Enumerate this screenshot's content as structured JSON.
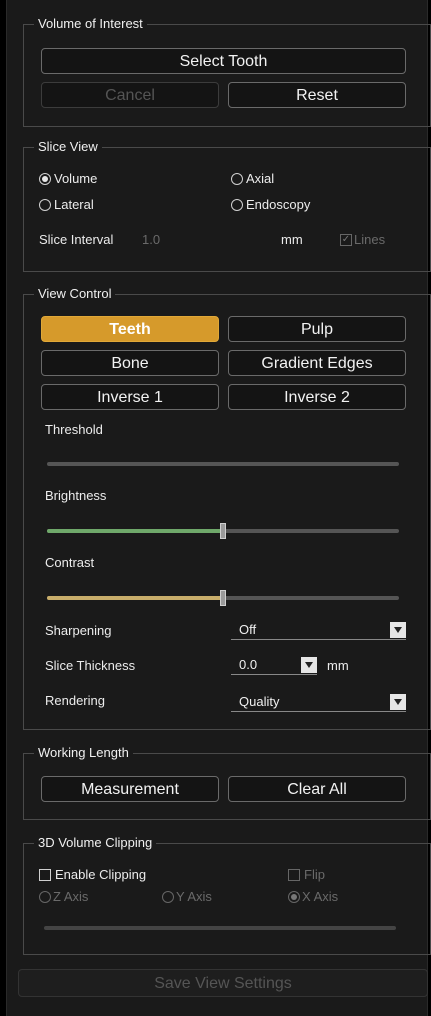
{
  "voi": {
    "title": "Volume of Interest",
    "select_tooth": "Select Tooth",
    "cancel": "Cancel",
    "reset": "Reset"
  },
  "slice_view": {
    "title": "Slice View",
    "options": [
      {
        "label": "Volume",
        "selected": true
      },
      {
        "label": "Axial",
        "selected": false
      },
      {
        "label": "Lateral",
        "selected": false
      },
      {
        "label": "Endoscopy",
        "selected": false
      }
    ],
    "interval_label": "Slice Interval",
    "interval_value": "1.0",
    "unit": "mm",
    "lines_label": "Lines",
    "lines_checked": true
  },
  "view_control": {
    "title": "View Control",
    "buttons": [
      "Teeth",
      "Pulp",
      "Bone",
      "Gradient Edges",
      "Inverse 1",
      "Inverse 2"
    ],
    "active_button": "Teeth",
    "threshold_label": "Threshold",
    "brightness_label": "Brightness",
    "brightness_level": 0.5,
    "brightness_color": "#6fa86a",
    "contrast_label": "Contrast",
    "contrast_level": 0.5,
    "contrast_color": "#c8ad6a",
    "sharpening_label": "Sharpening",
    "sharpening_value": "Off",
    "slice_thickness_label": "Slice Thickness",
    "slice_thickness_value": "0.0",
    "slice_thickness_unit": "mm",
    "rendering_label": "Rendering",
    "rendering_value": "Quality"
  },
  "working_length": {
    "title": "Working Length",
    "measurement": "Measurement",
    "clear_all": "Clear All"
  },
  "clipping": {
    "title": "3D Volume Clipping",
    "enable_label": "Enable Clipping",
    "flip_label": "Flip",
    "axes": [
      {
        "label": "Z Axis",
        "selected": false
      },
      {
        "label": "Y Axis",
        "selected": false
      },
      {
        "label": "X Axis",
        "selected": true
      }
    ]
  },
  "save_label": "Save View Settings",
  "accent_color": "#d69a2b"
}
